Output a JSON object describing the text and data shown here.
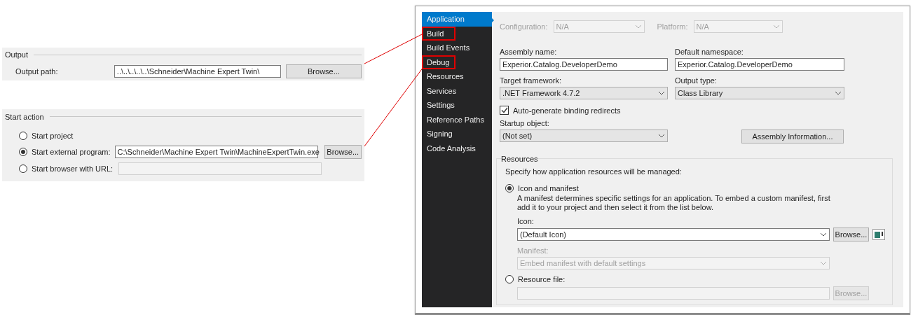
{
  "output_section": {
    "title": "Output",
    "path_label": "Output path:",
    "path_value": "..\\..\\..\\..\\..\\Schneider\\Machine Expert Twin\\",
    "browse": "Browse..."
  },
  "start_action": {
    "title": "Start action",
    "options": [
      {
        "kind": "plain",
        "label": "Start project",
        "selected": false
      },
      {
        "kind": "path",
        "label": "Start external program:",
        "selected": true,
        "value": "C:\\Schneider\\Machine Expert Twin\\MachineExpertTwin.exe",
        "browse": "Browse..."
      },
      {
        "kind": "url",
        "label": "Start browser with URL:",
        "selected": false
      }
    ]
  },
  "sidebar": {
    "items": [
      {
        "label": "Application",
        "selected": true,
        "highlighted": false
      },
      {
        "label": "Build",
        "selected": false,
        "highlighted": true
      },
      {
        "label": "Build Events",
        "selected": false,
        "highlighted": false
      },
      {
        "label": "Debug",
        "selected": false,
        "highlighted": true
      },
      {
        "label": "Resources",
        "selected": false,
        "highlighted": false
      },
      {
        "label": "Services",
        "selected": false,
        "highlighted": false
      },
      {
        "label": "Settings",
        "selected": false,
        "highlighted": false
      },
      {
        "label": "Reference Paths",
        "selected": false,
        "highlighted": false
      },
      {
        "label": "Signing",
        "selected": false,
        "highlighted": false
      },
      {
        "label": "Code Analysis",
        "selected": false,
        "highlighted": false
      }
    ]
  },
  "configuration": {
    "label": "Configuration:",
    "value": "N/A"
  },
  "platform": {
    "label": "Platform:",
    "value": "N/A"
  },
  "assembly_name": {
    "label": "Assembly name:",
    "value": "Experior.Catalog.DeveloperDemo"
  },
  "default_namespace": {
    "label": "Default namespace:",
    "value": "Experior.Catalog.DeveloperDemo"
  },
  "target_framework": {
    "label": "Target framework:",
    "value": ".NET Framework 4.7.2"
  },
  "output_type": {
    "label": "Output type:",
    "value": "Class Library"
  },
  "binding_redirects": {
    "label": "Auto-generate binding redirects",
    "checked": true
  },
  "startup_object": {
    "label": "Startup object:",
    "value": "(Not set)"
  },
  "assembly_info_button": "Assembly Information...",
  "resources": {
    "title": "Resources",
    "prompt": "Specify how application resources will be managed:",
    "icon_and_manifest": {
      "label": "Icon and manifest",
      "selected": true
    },
    "description": "A manifest determines specific settings for an application. To embed a custom manifest, first add it to your project and then select it from the list below.",
    "icon_label": "Icon:",
    "icon_value": "(Default Icon)",
    "icon_browse": "Browse...",
    "manifest_label": "Manifest:",
    "manifest_value": "Embed manifest with default settings",
    "resource_file": {
      "label": "Resource file:",
      "selected": false
    },
    "resource_browse": "Browse..."
  }
}
